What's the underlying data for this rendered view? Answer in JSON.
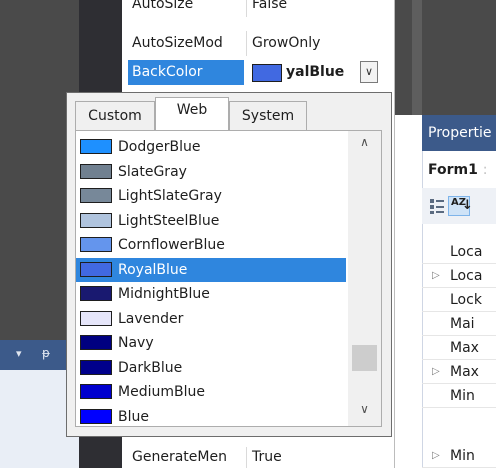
{
  "property_grid": {
    "rows": [
      {
        "name": "AutoSize",
        "value": "False"
      },
      {
        "name": "AutoSizeMod",
        "value": "GrowOnly"
      }
    ],
    "selected_row": {
      "name": "BackColor",
      "value_suffix": "yalBlue",
      "value_full": "RoyalBlue",
      "dropdown_glyph": "∨"
    },
    "bottom_row": {
      "name": "GenerateMen",
      "value": "True"
    }
  },
  "color_picker": {
    "tabs": [
      {
        "label": "Custom",
        "active": false
      },
      {
        "label": "Web",
        "active": true
      },
      {
        "label": "System",
        "active": false
      }
    ],
    "items": [
      {
        "name": "DodgerBlue",
        "color": "#1e90ff"
      },
      {
        "name": "SlateGray",
        "color": "#708090"
      },
      {
        "name": "LightSlateGray",
        "color": "#778899"
      },
      {
        "name": "LightSteelBlue",
        "color": "#b0c4de"
      },
      {
        "name": "CornflowerBlue",
        "color": "#6495ed"
      },
      {
        "name": "RoyalBlue",
        "color": "#4169e1",
        "selected": true
      },
      {
        "name": "MidnightBlue",
        "color": "#191970"
      },
      {
        "name": "Lavender",
        "color": "#e6e6fa"
      },
      {
        "name": "Navy",
        "color": "#000080"
      },
      {
        "name": "DarkBlue",
        "color": "#00008b"
      },
      {
        "name": "MediumBlue",
        "color": "#0000cd"
      },
      {
        "name": "Blue",
        "color": "#0000ff"
      }
    ],
    "scrollbar": {
      "up_glyph": "∧",
      "down_glyph": "∨"
    }
  },
  "properties_panel": {
    "title": "Propertie",
    "object": "Form1",
    "object_sep": ":",
    "az_icon_letters": "AZ",
    "rows": [
      {
        "label": "Loca",
        "expandable": false
      },
      {
        "label": "Loca",
        "expandable": true
      },
      {
        "label": "Lock",
        "expandable": false
      },
      {
        "label": "Mai",
        "expandable": false
      },
      {
        "label": "Max",
        "expandable": false
      },
      {
        "label": "Max",
        "expandable": true
      },
      {
        "label": "Min",
        "expandable": false
      },
      {
        "label": "Min",
        "expandable": true
      }
    ],
    "expander_glyph": "▷"
  },
  "tool_window": {
    "dropdown_glyph": "▾",
    "pin_glyph": "ᵽ"
  },
  "colors": {
    "selection": "#2f86de",
    "panel_title": "#3c5a8a"
  }
}
